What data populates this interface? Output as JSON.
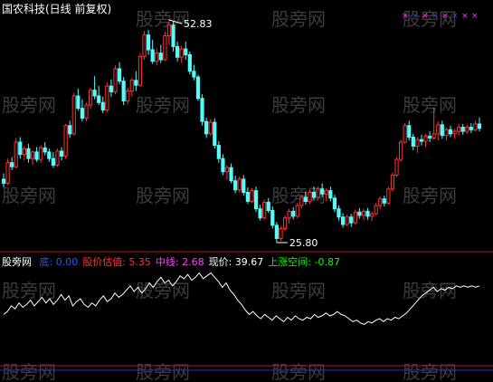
{
  "header": {
    "title": "国农科技(日线 前复权)"
  },
  "watermark": "股旁网",
  "indicator_bar": {
    "name": "股旁网",
    "items": [
      {
        "label": "底:",
        "value": "0.00",
        "color": "#3050ff"
      },
      {
        "label": "股价估值:",
        "value": "5.35",
        "color": "#ff3030"
      },
      {
        "label": "中线:",
        "value": "2.68",
        "color": "#ff40ff"
      },
      {
        "label": "现价:",
        "value": "39.67",
        "color": "#ffffff"
      },
      {
        "label": "上涨空间:",
        "value": "-0.87",
        "color": "#00ff00"
      }
    ]
  },
  "chart_data": [
    {
      "type": "candlestick",
      "high_label": "52.83",
      "low_label": "25.80",
      "up_color": "#ff3232",
      "down_color": "#54fcfc",
      "candles": [
        [
          33.5,
          34.2,
          32.5,
          33.0
        ],
        [
          33.0,
          36.0,
          32.8,
          35.5
        ],
        [
          35.5,
          36.2,
          34.6,
          35.0
        ],
        [
          35.0,
          38.5,
          34.8,
          38.0
        ],
        [
          38.0,
          38.6,
          36.0,
          36.5
        ],
        [
          36.5,
          37.5,
          35.8,
          37.2
        ],
        [
          37.2,
          37.8,
          35.5,
          36.0
        ],
        [
          36.0,
          37.0,
          35.2,
          36.8
        ],
        [
          36.8,
          37.4,
          35.6,
          35.9
        ],
        [
          35.9,
          37.6,
          35.5,
          37.3
        ],
        [
          37.3,
          38.0,
          36.4,
          36.8
        ],
        [
          36.8,
          37.2,
          35.6,
          36.0
        ],
        [
          36.0,
          36.8,
          34.9,
          35.2
        ],
        [
          35.2,
          37.2,
          35.0,
          36.9
        ],
        [
          36.9,
          37.4,
          35.8,
          36.3
        ],
        [
          36.3,
          40.2,
          36.0,
          40.0
        ],
        [
          40.0,
          40.6,
          38.5,
          39.0
        ],
        [
          39.0,
          44.0,
          38.8,
          43.6
        ],
        [
          43.6,
          44.5,
          41.8,
          42.1
        ],
        [
          42.1,
          43.2,
          40.5,
          40.9
        ],
        [
          40.9,
          42.8,
          40.5,
          42.5
        ],
        [
          42.5,
          44.6,
          42.0,
          44.3
        ],
        [
          44.3,
          46.0,
          43.2,
          43.6
        ],
        [
          43.6,
          44.8,
          42.5,
          42.8
        ],
        [
          42.8,
          43.5,
          41.5,
          41.9
        ],
        [
          41.9,
          45.2,
          41.6,
          44.8
        ],
        [
          44.8,
          45.6,
          43.5,
          44.1
        ],
        [
          44.1,
          47.3,
          43.8,
          46.9
        ],
        [
          46.9,
          47.7,
          45.0,
          45.4
        ],
        [
          45.4,
          45.9,
          42.5,
          43.0
        ],
        [
          43.0,
          44.6,
          42.6,
          44.2
        ],
        [
          44.2,
          45.8,
          43.5,
          45.5
        ],
        [
          45.5,
          46.6,
          44.2,
          44.9
        ],
        [
          44.9,
          48.8,
          44.7,
          48.4
        ],
        [
          48.4,
          51.5,
          48.0,
          51.0
        ],
        [
          51.0,
          51.6,
          48.6,
          49.2
        ],
        [
          49.2,
          50.4,
          47.5,
          47.8
        ],
        [
          47.8,
          49.4,
          47.3,
          48.8
        ],
        [
          48.8,
          49.8,
          47.6,
          48.0
        ],
        [
          48.0,
          51.4,
          47.8,
          50.9
        ],
        [
          50.9,
          52.83,
          49.8,
          52.2
        ],
        [
          52.2,
          52.6,
          49.0,
          49.6
        ],
        [
          49.6,
          50.2,
          47.8,
          48.3
        ],
        [
          48.3,
          49.7,
          47.6,
          49.3
        ],
        [
          49.3,
          50.2,
          48.0,
          48.6
        ],
        [
          48.6,
          49.0,
          46.2,
          46.6
        ],
        [
          46.6,
          47.4,
          45.5,
          45.9
        ],
        [
          45.9,
          46.2,
          43.0,
          43.3
        ],
        [
          43.3,
          43.8,
          40.0,
          40.5
        ],
        [
          40.5,
          41.0,
          38.5,
          39.0
        ],
        [
          39.0,
          40.8,
          38.8,
          40.4
        ],
        [
          40.4,
          40.9,
          37.2,
          37.6
        ],
        [
          37.6,
          38.1,
          35.5,
          36.0
        ],
        [
          36.0,
          36.5,
          34.0,
          34.4
        ],
        [
          34.4,
          35.2,
          33.4,
          34.9
        ],
        [
          34.9,
          35.4,
          33.0,
          33.3
        ],
        [
          33.3,
          33.9,
          31.8,
          32.2
        ],
        [
          32.2,
          33.8,
          31.9,
          33.5
        ],
        [
          33.5,
          34.0,
          31.5,
          31.9
        ],
        [
          31.9,
          32.5,
          30.5,
          30.8
        ],
        [
          30.8,
          32.4,
          30.6,
          32.1
        ],
        [
          32.1,
          32.6,
          29.5,
          29.9
        ],
        [
          29.9,
          30.4,
          28.5,
          28.8
        ],
        [
          28.8,
          31.0,
          28.6,
          30.7
        ],
        [
          30.7,
          31.2,
          29.4,
          29.7
        ],
        [
          29.7,
          30.2,
          27.5,
          27.9
        ],
        [
          27.9,
          28.3,
          25.8,
          26.3
        ],
        [
          26.3,
          27.8,
          26.0,
          27.5
        ],
        [
          27.5,
          29.1,
          27.2,
          28.8
        ],
        [
          28.8,
          29.9,
          28.1,
          29.6
        ],
        [
          29.6,
          30.1,
          28.6,
          29.0
        ],
        [
          29.0,
          30.6,
          28.8,
          30.3
        ],
        [
          30.3,
          31.6,
          29.9,
          31.3
        ],
        [
          31.3,
          32.0,
          30.4,
          30.8
        ],
        [
          30.8,
          32.2,
          30.5,
          31.9
        ],
        [
          31.9,
          32.6,
          30.9,
          31.3
        ],
        [
          31.3,
          32.6,
          31.0,
          32.3
        ],
        [
          32.3,
          33.0,
          31.3,
          31.7
        ],
        [
          31.7,
          32.4,
          30.8,
          32.1
        ],
        [
          32.1,
          32.6,
          30.8,
          31.2
        ],
        [
          31.2,
          31.6,
          29.5,
          29.9
        ],
        [
          29.9,
          30.3,
          28.5,
          28.9
        ],
        [
          28.9,
          29.4,
          27.6,
          28.0
        ],
        [
          28.0,
          29.2,
          27.8,
          28.9
        ],
        [
          28.9,
          29.3,
          27.7,
          28.2
        ],
        [
          28.2,
          29.8,
          28.0,
          29.5
        ],
        [
          29.5,
          30.0,
          28.7,
          29.1
        ],
        [
          29.1,
          29.9,
          28.6,
          29.6
        ],
        [
          29.6,
          30.0,
          28.6,
          29.0
        ],
        [
          29.0,
          29.6,
          28.4,
          29.3
        ],
        [
          29.3,
          30.6,
          29.1,
          30.3
        ],
        [
          30.3,
          31.4,
          29.9,
          31.1
        ],
        [
          31.1,
          31.5,
          30.2,
          30.6
        ],
        [
          30.6,
          32.6,
          30.4,
          32.3
        ],
        [
          32.3,
          34.3,
          32.0,
          34.0
        ],
        [
          34.0,
          36.2,
          33.8,
          35.9
        ],
        [
          35.9,
          38.3,
          35.6,
          38.0
        ],
        [
          38.0,
          40.3,
          37.8,
          40.0
        ],
        [
          40.0,
          40.6,
          38.2,
          38.6
        ],
        [
          38.6,
          39.0,
          37.0,
          37.5
        ],
        [
          37.5,
          38.6,
          36.7,
          38.3
        ],
        [
          38.3,
          38.9,
          37.6,
          38.1
        ],
        [
          38.1,
          39.0,
          37.4,
          38.7
        ],
        [
          38.7,
          39.3,
          38.0,
          38.5
        ],
        [
          38.5,
          42.2,
          38.3,
          39.0
        ],
        [
          39.0,
          40.5,
          38.2,
          40.1
        ],
        [
          40.1,
          40.6,
          38.4,
          38.8
        ],
        [
          38.8,
          39.8,
          38.2,
          39.5
        ],
        [
          39.5,
          40.0,
          38.6,
          39.0
        ],
        [
          39.0,
          39.6,
          38.4,
          39.3
        ],
        [
          39.3,
          40.2,
          38.8,
          39.8
        ],
        [
          39.8,
          40.2,
          38.9,
          39.3
        ],
        [
          39.3,
          40.1,
          39.0,
          39.8
        ],
        [
          39.8,
          40.3,
          39.1,
          39.5
        ],
        [
          39.5,
          40.6,
          39.3,
          40.2
        ],
        [
          40.2,
          41.0,
          39.3,
          39.67
        ]
      ]
    },
    {
      "type": "line",
      "series_color": "#ffffff",
      "markers": [
        "#ff30ff",
        "#4040ff",
        "#ff30ff",
        "#4040ff",
        "#ff30ff",
        "#4040ff",
        "#ff30ff",
        "#ff30ff"
      ],
      "values": [
        4.6,
        4.8,
        5.2,
        5.0,
        5.4,
        5.1,
        5.3,
        5.6,
        5.2,
        5.5,
        5.8,
        5.4,
        5.7,
        5.3,
        5.6,
        6.0,
        5.6,
        5.9,
        5.2,
        5.5,
        5.7,
        5.3,
        5.1,
        5.4,
        5.2,
        5.6,
        5.9,
        5.5,
        5.7,
        6.1,
        5.8,
        6.0,
        6.3,
        6.6,
        6.2,
        6.5,
        6.1,
        6.4,
        6.8,
        6.5,
        6.9,
        7.2,
        6.8,
        7.0,
        6.6,
        6.9,
        7.3,
        7.1,
        7.4,
        7.0,
        7.2,
        7.5,
        7.1,
        7.3,
        7.5,
        7.2,
        6.9,
        6.5,
        6.8,
        6.3,
        6.0,
        5.6,
        5.3,
        4.9,
        4.6,
        4.8,
        4.5,
        4.3,
        4.6,
        4.4,
        4.2,
        4.5,
        4.3,
        4.1,
        4.4,
        4.2,
        4.5,
        4.3,
        4.2,
        4.4,
        4.3,
        4.6,
        4.4,
        4.5,
        4.7,
        4.5,
        4.6,
        4.8,
        4.6,
        4.5,
        4.3,
        4.1,
        4.2,
        4.0,
        3.9,
        4.1,
        4.0,
        4.2,
        4.3,
        4.1,
        4.3,
        4.2,
        4.4,
        4.3,
        4.5,
        4.7,
        5.0,
        5.3,
        5.6,
        5.9,
        6.1,
        6.3,
        6.5,
        6.2,
        6.4,
        6.3,
        6.5,
        6.4,
        6.6,
        6.5,
        6.6,
        6.5,
        6.6,
        6.5,
        6.6
      ]
    }
  ]
}
